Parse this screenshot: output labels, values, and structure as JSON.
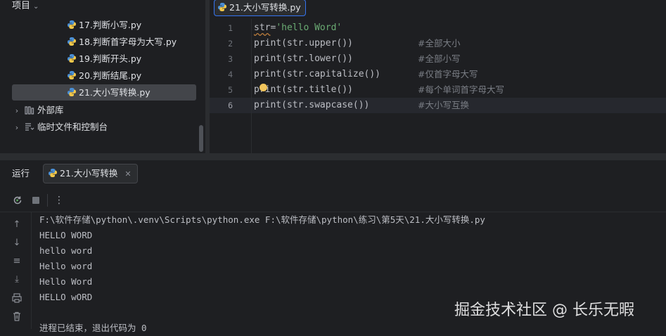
{
  "project": {
    "header": "项目",
    "files": [
      "17.判断小写.py",
      "18.判断首字母为大写.py",
      "19.判断开头.py",
      "20.判断结尾.py",
      "21.大小写转换.py"
    ],
    "external_libs": "外部库",
    "scratches": "临时文件和控制台"
  },
  "editor": {
    "tab_label": "21.大小写转换.py",
    "line_numbers": [
      "1",
      "2",
      "3",
      "4",
      "5",
      "6"
    ],
    "lines": {
      "l1_var": "str",
      "l1_rest": "=",
      "l1_str": "'hello Word'",
      "l2": "print(str.upper())",
      "l3": "print(str.lower())",
      "l4": "print(str.capitalize())",
      "l5": "print(str.title())",
      "l6": "print(str.swapcase())"
    },
    "comments": [
      "#全部大小",
      "#全部小写",
      "#仅首字母大写",
      "#每个单词首字母大写",
      "#大小写互换"
    ]
  },
  "run": {
    "title": "运行",
    "tab_label": "21.大小写转换",
    "output": [
      "F:\\软件存储\\python\\.venv\\Scripts\\python.exe F:\\软件存储\\python\\练习\\第5天\\21.大小写转换.py",
      "HELLO WORD",
      "hello word",
      "Hello word",
      "Hello Word",
      "HELLO wORD",
      "",
      "进程已结束，退出代码为 0"
    ]
  },
  "watermark": "掘金技术社区 @ 长乐无暇",
  "colors": {
    "background": "#1e1f22",
    "panel_border": "#2b2d30",
    "selection": "#43454a",
    "tab_accent": "#3574f0",
    "string": "#6aab73",
    "comment": "#7a7e85"
  }
}
